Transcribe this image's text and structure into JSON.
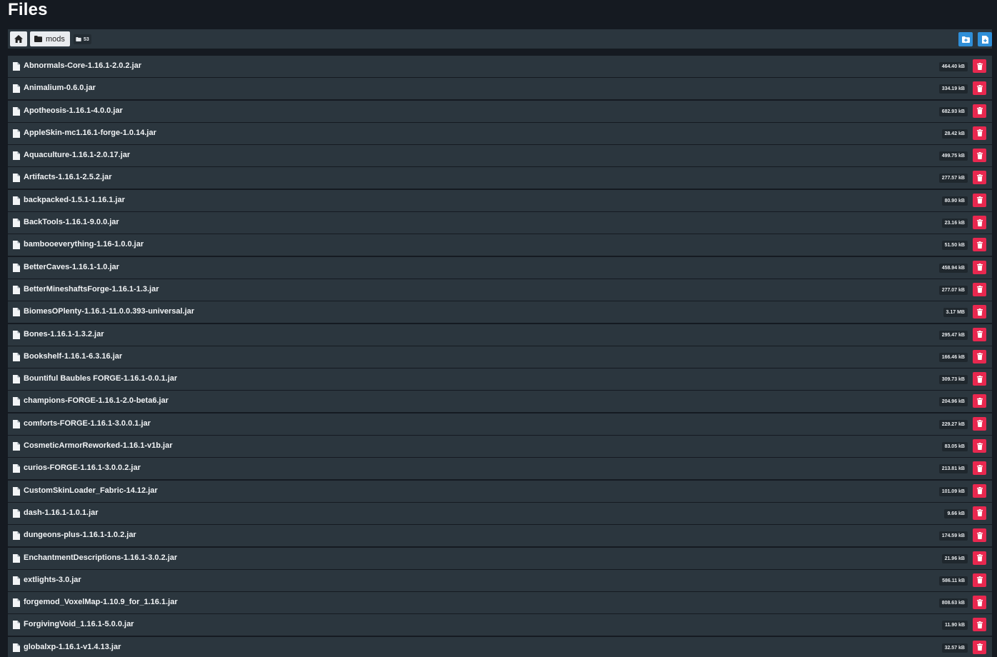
{
  "page": {
    "title": "Files"
  },
  "toolbar": {
    "breadcrumb_folder": "mods",
    "item_count": "53"
  },
  "colors": {
    "accent": "#2f8fd8",
    "danger": "#e8284f",
    "row_bg": "#2b363e",
    "page_bg": "#151a21"
  },
  "files": [
    {
      "name": "Abnormals-Core-1.16.1-2.0.2.jar",
      "size": "464.40 kB"
    },
    {
      "name": "Animalium-0.6.0.jar",
      "size": "334.19 kB"
    },
    {
      "name": "Apotheosis-1.16.1-4.0.0.jar",
      "size": "682.93 kB"
    },
    {
      "name": "AppleSkin-mc1.16.1-forge-1.0.14.jar",
      "size": "28.42 kB"
    },
    {
      "name": "Aquaculture-1.16.1-2.0.17.jar",
      "size": "499.75 kB"
    },
    {
      "name": "Artifacts-1.16.1-2.5.2.jar",
      "size": "277.57 kB"
    },
    {
      "name": "backpacked-1.5.1-1.16.1.jar",
      "size": "80.90 kB"
    },
    {
      "name": "BackTools-1.16.1-9.0.0.jar",
      "size": "23.16 kB"
    },
    {
      "name": "bambooeverything-1.16-1.0.0.jar",
      "size": "51.50 kB"
    },
    {
      "name": "BetterCaves-1.16.1-1.0.jar",
      "size": "458.94 kB"
    },
    {
      "name": "BetterMineshaftsForge-1.16.1-1.3.jar",
      "size": "277.07 kB"
    },
    {
      "name": "BiomesOPlenty-1.16.1-11.0.0.393-universal.jar",
      "size": "3.17 MB"
    },
    {
      "name": "Bones-1.16.1-1.3.2.jar",
      "size": "295.47 kB"
    },
    {
      "name": "Bookshelf-1.16.1-6.3.16.jar",
      "size": "166.46 kB"
    },
    {
      "name": "Bountiful Baubles FORGE-1.16.1-0.0.1.jar",
      "size": "309.73 kB"
    },
    {
      "name": "champions-FORGE-1.16.1-2.0-beta6.jar",
      "size": "204.96 kB"
    },
    {
      "name": "comforts-FORGE-1.16.1-3.0.0.1.jar",
      "size": "229.27 kB"
    },
    {
      "name": "CosmeticArmorReworked-1.16.1-v1b.jar",
      "size": "83.05 kB"
    },
    {
      "name": "curios-FORGE-1.16.1-3.0.0.2.jar",
      "size": "213.81 kB"
    },
    {
      "name": "CustomSkinLoader_Fabric-14.12.jar",
      "size": "101.09 kB"
    },
    {
      "name": "dash-1.16.1-1.0.1.jar",
      "size": "9.66 kB"
    },
    {
      "name": "dungeons-plus-1.16.1-1.0.2.jar",
      "size": "174.59 kB"
    },
    {
      "name": "EnchantmentDescriptions-1.16.1-3.0.2.jar",
      "size": "21.96 kB"
    },
    {
      "name": "extlights-3.0.jar",
      "size": "586.11 kB"
    },
    {
      "name": "forgemod_VoxelMap-1.10.9_for_1.16.1.jar",
      "size": "808.63 kB"
    },
    {
      "name": "ForgivingVoid_1.16.1-5.0.0.jar",
      "size": "11.90 kB"
    },
    {
      "name": "globalxp-1.16.1-v1.4.13.jar",
      "size": "32.57 kB"
    }
  ]
}
